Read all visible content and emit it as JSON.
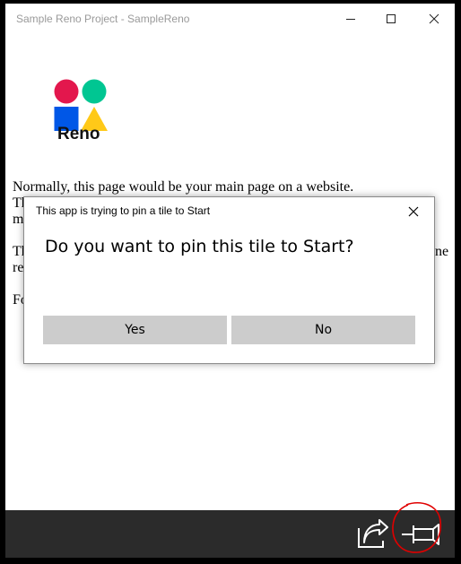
{
  "window": {
    "title": "Sample Reno Project - SampleReno"
  },
  "logo": {
    "text": "Reno",
    "colors": {
      "circle_left": "#E3174D",
      "circle_right": "#00C692",
      "square": "#0057E7",
      "triangle": "#FFC918"
    }
  },
  "content": {
    "paragraphs": [
      {
        "lines": [
          "Normally, this page would be your main page on a website.",
          "Th",
          "m"
        ]
      },
      {
        "lines": [
          "Th",
          "re"
        ]
      },
      {
        "lines": [
          "Fo"
        ]
      }
    ],
    "paragraph_tail": "ne"
  },
  "dialog": {
    "caption": "This app is trying to pin a tile to Start",
    "message": "Do you want to pin this tile to Start?",
    "yes_label": "Yes",
    "no_label": "No"
  },
  "appbar": {
    "icons": [
      "share-icon",
      "pin-icon"
    ],
    "highlight_color": "#E00000"
  }
}
